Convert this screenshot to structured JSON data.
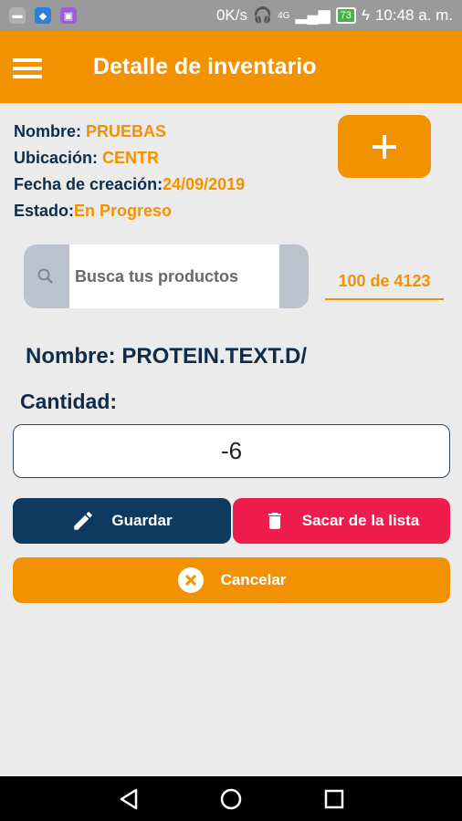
{
  "status_bar": {
    "speed": "0K/s",
    "network": "4G",
    "battery": "73",
    "time": "10:48 a. m."
  },
  "app_bar": {
    "title": "Detalle de inventario"
  },
  "inventory": {
    "name_label": "Nombre:",
    "name_value": "PRUEBAS",
    "location_label": "Ubicación:",
    "location_value": "CENTR",
    "date_label": "Fecha de creación:",
    "date_value": "24/09/2019",
    "status_label": "Estado:",
    "status_value": "En Progreso"
  },
  "add_button": {
    "icon": "plus-icon"
  },
  "search": {
    "placeholder": "Busca tus productos",
    "value": ""
  },
  "counter": "100 de 4123",
  "product": {
    "name_text": "Nombre: PROTEIN.TEXT.D/"
  },
  "quantity": {
    "label": "Cantidad:",
    "value": "-6"
  },
  "buttons": {
    "save": "Guardar",
    "remove": "Sacar de la lista",
    "cancel": "Cancelar"
  },
  "colors": {
    "accent": "#f39200",
    "navy": "#0e3a5f",
    "danger": "#ef1c4e"
  }
}
